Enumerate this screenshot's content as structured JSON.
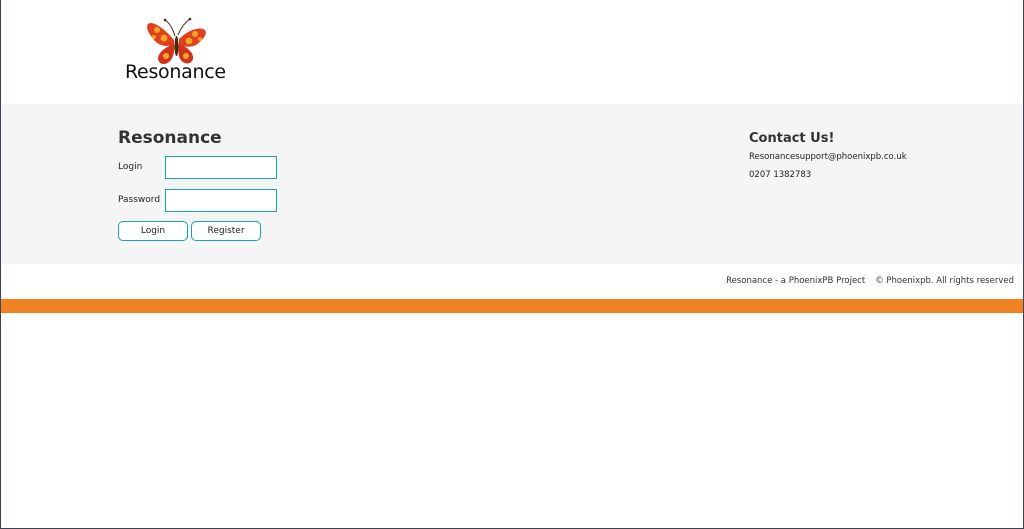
{
  "header": {
    "logo_text": "Resonance",
    "logo_icon": "butterfly-icon"
  },
  "login_form": {
    "title": "Resonance",
    "login_label": "Login",
    "login_value": "",
    "password_label": "Password",
    "password_value": "",
    "login_button": "Login",
    "register_button": "Register"
  },
  "contact": {
    "title": "Contact Us!",
    "email": "Resonancesupport@phoenixpb.co.uk",
    "phone": "0207 1382783"
  },
  "footer": {
    "project": "Resonance - a PhoenixPB Project",
    "copyright": "© Phoenixpb. All rights reserved"
  },
  "colors": {
    "accent_teal": "#1aa3a6",
    "orange_bar": "#f08224",
    "band_background": "#f5f5f5"
  }
}
